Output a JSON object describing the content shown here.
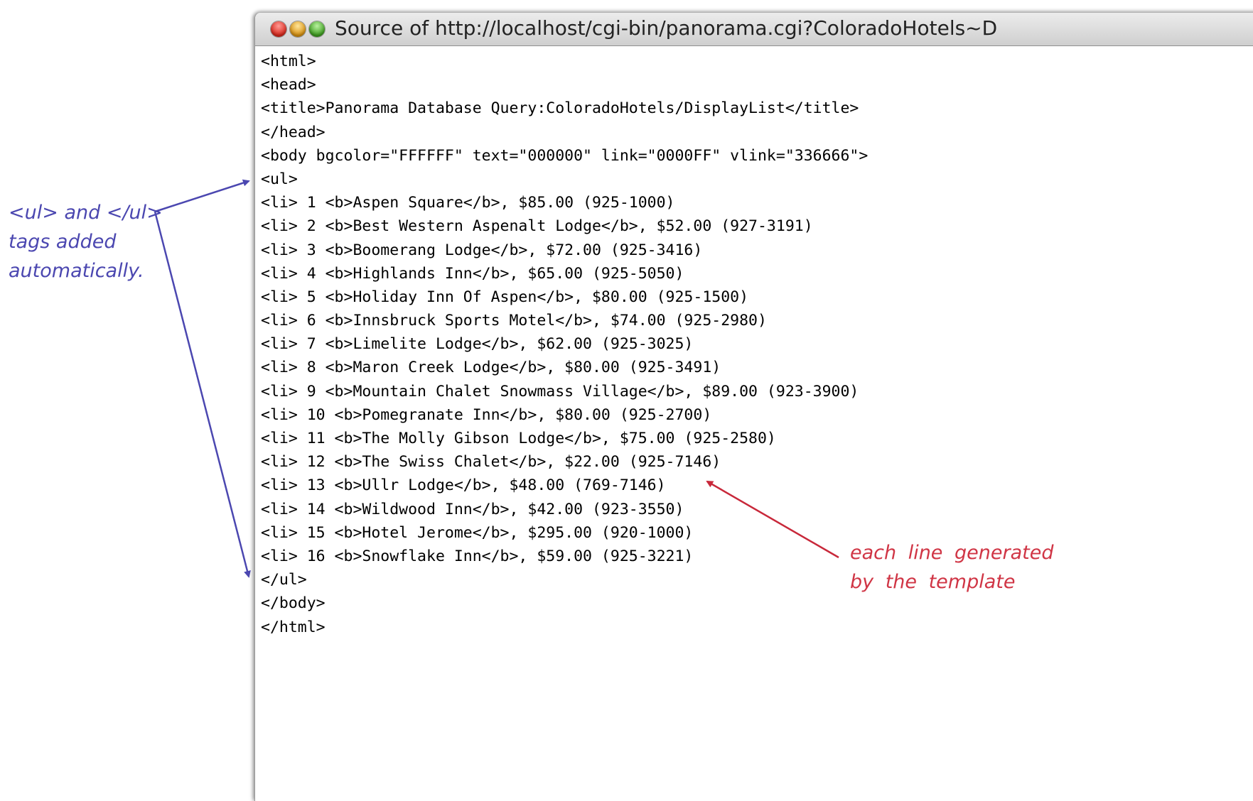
{
  "window": {
    "title": "Source of http://localhost/cgi-bin/panorama.cgi?ColoradoHotels~D"
  },
  "source_lines": [
    "<html>",
    "<head>",
    "<title>Panorama Database Query:ColoradoHotels/DisplayList</title>",
    "</head>",
    "<body bgcolor=\"FFFFFF\" text=\"000000\" link=\"0000FF\" vlink=\"336666\">",
    "<ul>",
    "<li> 1 <b>Aspen Square</b>, $85.00 (925-1000)",
    "<li> 2 <b>Best Western Aspenalt Lodge</b>, $52.00 (927-3191)",
    "<li> 3 <b>Boomerang Lodge</b>, $72.00 (925-3416)",
    "<li> 4 <b>Highlands Inn</b>, $65.00 (925-5050)",
    "<li> 5 <b>Holiday Inn Of Aspen</b>, $80.00 (925-1500)",
    "<li> 6 <b>Innsbruck Sports Motel</b>, $74.00 (925-2980)",
    "<li> 7 <b>Limelite Lodge</b>, $62.00 (925-3025)",
    "<li> 8 <b>Maron Creek Lodge</b>, $80.00 (925-3491)",
    "<li> 9 <b>Mountain Chalet Snowmass Village</b>, $89.00 (923-3900)",
    "<li> 10 <b>Pomegranate Inn</b>, $80.00 (925-2700)",
    "<li> 11 <b>The Molly Gibson Lodge</b>, $75.00 (925-2580)",
    "<li> 12 <b>The Swiss Chalet</b>, $22.00 (925-7146)",
    "<li> 13 <b>Ullr Lodge</b>, $48.00 (769-7146)",
    "<li> 14 <b>Wildwood Inn</b>, $42.00 (923-3550)",
    "<li> 15 <b>Hotel Jerome</b>, $295.00 (920-1000)",
    "<li> 16 <b>Snowflake Inn</b>, $59.00 (925-3221)",
    "</ul>",
    "</body>",
    "</html>"
  ],
  "annotations": {
    "left": {
      "line1": "<ul> and </ul>",
      "line2": "tags added",
      "line3": "automatically.",
      "color": "#4b47b0"
    },
    "right": {
      "line1": "each line generated",
      "line2": "by the template",
      "color": "#d03545"
    }
  }
}
